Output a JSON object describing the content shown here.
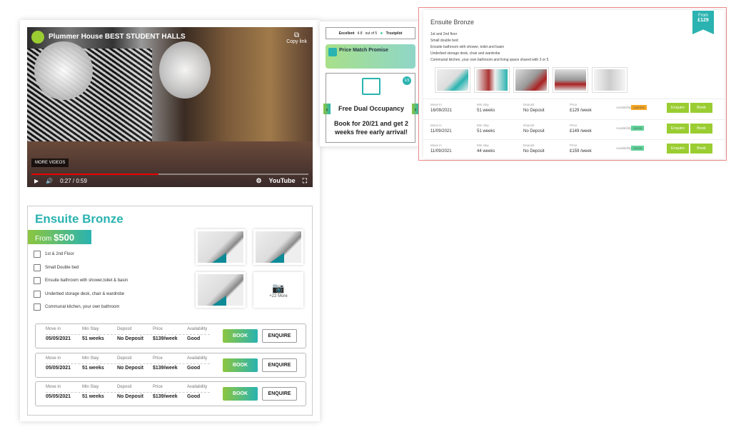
{
  "video": {
    "title": "Plummer House BEST STUDENT HALLS",
    "copy_link": "Copy link",
    "more_videos": "MORE VIDEOS",
    "time": "0:27 / 0:59",
    "progress": 0.46,
    "brand": "YouTube"
  },
  "room": {
    "title": "Ensuite Bronze",
    "from_label": "From",
    "from_price": "$500",
    "features": [
      "1st & 2nd Floor",
      "Small Double bed",
      "Ensuite bathroom with shower,toilet & basin",
      "Underbed storage desk, chair & wardrobe",
      "Communal kitchen, your own bathroom"
    ],
    "feature_icons": [
      "building-icon",
      "bed-icon",
      "bath-icon",
      "desk-icon",
      "kitchen-icon"
    ],
    "more_photos": "+22 More",
    "headers": [
      "Move in",
      "Min Stay",
      "Deposit",
      "Price",
      "Availability"
    ],
    "rows": [
      [
        "05/05/2021",
        "51 weeks",
        "No Deposit",
        "$139/week",
        "Good"
      ],
      [
        "05/05/2021",
        "51 weeks",
        "No Deposit",
        "$139/week",
        "Good"
      ],
      [
        "05/05/2021",
        "51 weeks",
        "No Deposit",
        "$139/week",
        "Good"
      ]
    ],
    "book": "BOOK",
    "enquire": "ENQUIRE"
  },
  "side": {
    "trust_label": "Excellent",
    "trust_score": "4.8",
    "trust_out_of": "out of 5",
    "trust_brand": "Trustpilot",
    "price_match": "Price Match Promise",
    "slide_count": "1/3",
    "offer_title": "Free Dual Occupancy",
    "offer_text": "Book for 20/21 and get 2 weeks free early arrival!"
  },
  "alt": {
    "title": "Ensuite Bronze",
    "ribbon_from": "From",
    "ribbon_price": "£129",
    "features": [
      "1st and 2nd floor",
      "Small double bed",
      "Ensuite bathroom with shower, toilet and basin",
      "Underbed storage desk, chair and wardrobe",
      "Communal kitchen, your own bathroom and living space shared with 3 or 5"
    ],
    "headers": [
      "Move in",
      "Min stay",
      "Deposit",
      "Price",
      "Availability"
    ],
    "rows": [
      {
        "move_in": "16/09/2021",
        "min_stay": "51 weeks",
        "deposit": "No Deposit",
        "price": "£129 /week",
        "availability": "LIMITED"
      },
      {
        "move_in": "11/09/2021",
        "min_stay": "51 weeks",
        "deposit": "No Deposit",
        "price": "£149 /week",
        "availability": "GOOD"
      },
      {
        "move_in": "11/09/2021",
        "min_stay": "44 weeks",
        "deposit": "No Deposit",
        "price": "£159 /week",
        "availability": "GOOD"
      }
    ],
    "enquire": "Enquire",
    "book": "Book"
  },
  "colors": {
    "teal": "#2ab3b0",
    "green": "#8cc63f",
    "lime": "#9acd32",
    "limited": "#f5a623",
    "good": "#5fd39a",
    "highlight_border": "#e88888"
  }
}
